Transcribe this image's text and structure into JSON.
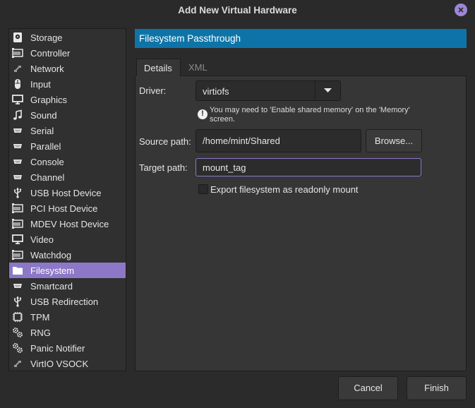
{
  "window": {
    "title": "Add New Virtual Hardware"
  },
  "sidebar": {
    "items": [
      {
        "label": "Storage",
        "icon": "storage-icon"
      },
      {
        "label": "Controller",
        "icon": "controller-icon"
      },
      {
        "label": "Network",
        "icon": "network-icon"
      },
      {
        "label": "Input",
        "icon": "mouse-icon"
      },
      {
        "label": "Graphics",
        "icon": "monitor-icon"
      },
      {
        "label": "Sound",
        "icon": "sound-icon"
      },
      {
        "label": "Serial",
        "icon": "serial-port-icon"
      },
      {
        "label": "Parallel",
        "icon": "parallel-port-icon"
      },
      {
        "label": "Console",
        "icon": "console-icon"
      },
      {
        "label": "Channel",
        "icon": "channel-icon"
      },
      {
        "label": "USB Host Device",
        "icon": "usb-icon"
      },
      {
        "label": "PCI Host Device",
        "icon": "pci-icon"
      },
      {
        "label": "MDEV Host Device",
        "icon": "mdev-icon"
      },
      {
        "label": "Video",
        "icon": "video-monitor-icon"
      },
      {
        "label": "Watchdog",
        "icon": "watchdog-icon"
      },
      {
        "label": "Filesystem",
        "icon": "folder-icon",
        "selected": true
      },
      {
        "label": "Smartcard",
        "icon": "smartcard-icon"
      },
      {
        "label": "USB Redirection",
        "icon": "usb-redirection-icon"
      },
      {
        "label": "TPM",
        "icon": "tpm-chip-icon"
      },
      {
        "label": "RNG",
        "icon": "rng-gears-icon"
      },
      {
        "label": "Panic Notifier",
        "icon": "panic-gears-icon"
      },
      {
        "label": "VirtIO VSOCK",
        "icon": "vsock-icon"
      }
    ]
  },
  "section": {
    "title": "Filesystem Passthrough"
  },
  "tabs": {
    "details": "Details",
    "xml": "XML"
  },
  "form": {
    "driver_label": "Driver:",
    "driver_value": "virtiofs",
    "info_text": "You may need to 'Enable shared memory' on the 'Memory' screen.",
    "source_label": "Source path:",
    "source_value": "/home/mint/Shared",
    "browse_label": "Browse...",
    "target_label": "Target path:",
    "target_value": "mount_tag",
    "readonly_label": "Export filesystem as readonly mount",
    "readonly_checked": false
  },
  "footer": {
    "cancel": "Cancel",
    "finish": "Finish"
  },
  "colors": {
    "accent": "#8c78c6",
    "header": "#0e74a8",
    "background": "#2b2b2b"
  }
}
